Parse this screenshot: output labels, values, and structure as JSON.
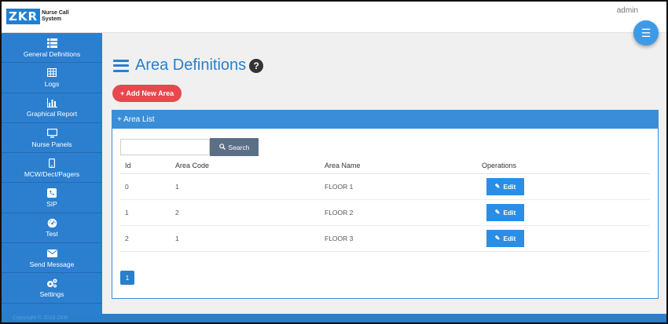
{
  "header": {
    "logo_mark": "ZKR",
    "logo_line1": "Nurse Call",
    "logo_line2": "System",
    "user": "admin"
  },
  "sidebar": {
    "items": [
      {
        "label": "General Definitions",
        "icon": "list-icon"
      },
      {
        "label": "Logs",
        "icon": "table-icon"
      },
      {
        "label": "Graphical Report",
        "icon": "bar-chart-icon"
      },
      {
        "label": "Nurse Panels",
        "icon": "monitor-icon"
      },
      {
        "label": "MCW/Dect/Pagers",
        "icon": "mobile-icon"
      },
      {
        "label": "SIP",
        "icon": "phone-icon"
      },
      {
        "label": "Test",
        "icon": "dashboard-icon"
      },
      {
        "label": "Send Message",
        "icon": "envelope-icon"
      },
      {
        "label": "Settings",
        "icon": "gears-icon"
      }
    ]
  },
  "main": {
    "title": "Area Definitions",
    "add_button": "+ Add New Area",
    "panel_title": "+ Area List",
    "search": {
      "value": "",
      "placeholder": "",
      "button": "Search"
    },
    "columns": [
      "Id",
      "Area Code",
      "Area Name",
      "Operations"
    ],
    "rows": [
      {
        "id": "0",
        "code": "1",
        "name": "FLOOR 1",
        "op": "Edit"
      },
      {
        "id": "1",
        "code": "2",
        "name": "FLOOR 2",
        "op": "Edit"
      },
      {
        "id": "2",
        "code": "1",
        "name": "FLOOR 3",
        "op": "Edit"
      }
    ],
    "page": "1"
  },
  "footer": {
    "text": "Copyright © 2018 ZKR"
  },
  "colors": {
    "accent": "#2c7fcf",
    "danger": "#e8474d",
    "search_button": "#5b6f87",
    "background": "#f0f0f0"
  }
}
